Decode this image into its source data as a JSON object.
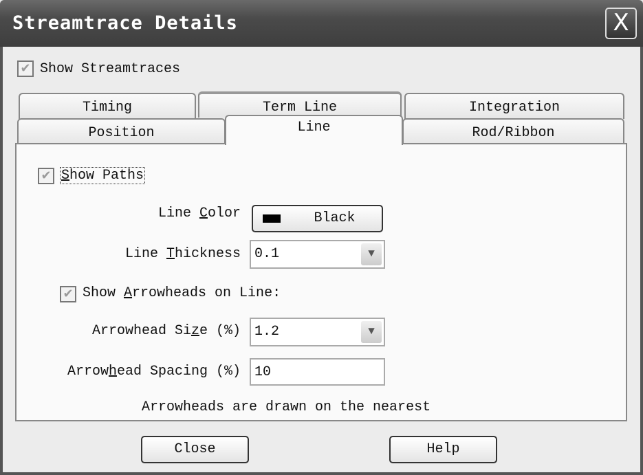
{
  "window": {
    "title": "Streamtrace Details",
    "close_glyph": "X"
  },
  "show_streamtraces": {
    "label": "Show Streamtraces",
    "checked": true
  },
  "tabs": {
    "row1": [
      "Timing",
      "Term Line",
      "Integration"
    ],
    "row2": [
      "Position",
      "Line",
      "Rod/Ribbon"
    ],
    "selected": "Line"
  },
  "line_tab": {
    "show_paths": {
      "pre": "",
      "key": "S",
      "post": "how Paths",
      "checked": true
    },
    "line_color": {
      "pre": "Line ",
      "key": "C",
      "post": "olor",
      "value": "Black",
      "swatch": "#000000"
    },
    "line_thickness": {
      "pre": "Line ",
      "key": "T",
      "post": "hickness",
      "value": "0.1"
    },
    "show_arrowheads": {
      "pre": "Show ",
      "key": "A",
      "post": "rrowheads on Line:",
      "checked": true
    },
    "arrowhead_size": {
      "pre": "Arrowhead Si",
      "key": "z",
      "post": "e (%)",
      "value": "1.2"
    },
    "arrowhead_spacing": {
      "pre": "Arrow",
      "key": "h",
      "post": "ead Spacing (%)",
      "value": "10"
    },
    "note": "Arrowheads are drawn on the nearest"
  },
  "buttons": {
    "close": "Close",
    "help": "Help"
  }
}
